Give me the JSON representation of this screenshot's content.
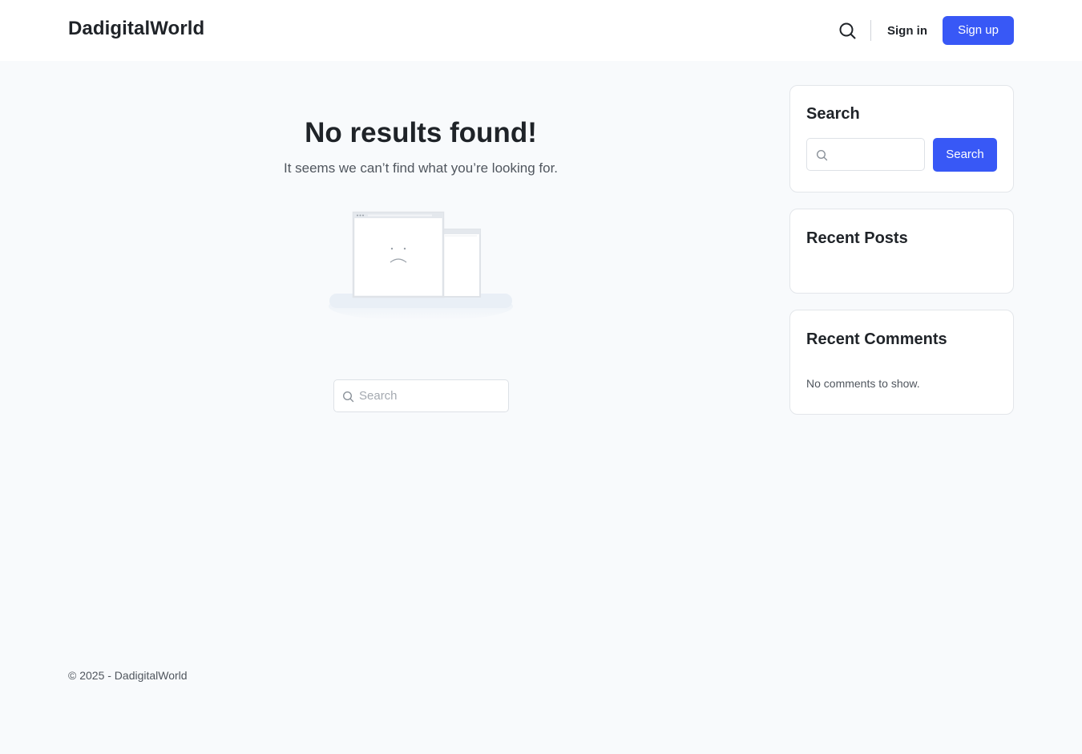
{
  "header": {
    "logo": "DadigitalWorld",
    "signin_label": "Sign in",
    "signup_label": "Sign up"
  },
  "main": {
    "title": "No results found!",
    "subtitle": "It seems we can’t find what you’re looking for.",
    "search_placeholder": "Search"
  },
  "sidebar": {
    "search_widget": {
      "title": "Search",
      "input_value": "",
      "button_label": "Search"
    },
    "recent_posts": {
      "title": "Recent Posts"
    },
    "recent_comments": {
      "title": "Recent Comments",
      "empty_text": "No comments to show."
    }
  },
  "footer": {
    "copyright": "© 2025 - DadigitalWorld"
  },
  "colors": {
    "accent": "#3858f6",
    "page_background": "#f8fafc"
  },
  "icons": {
    "header_search": "search-icon",
    "input_search": "search-icon",
    "illustration": "sad-browser-illustration"
  }
}
